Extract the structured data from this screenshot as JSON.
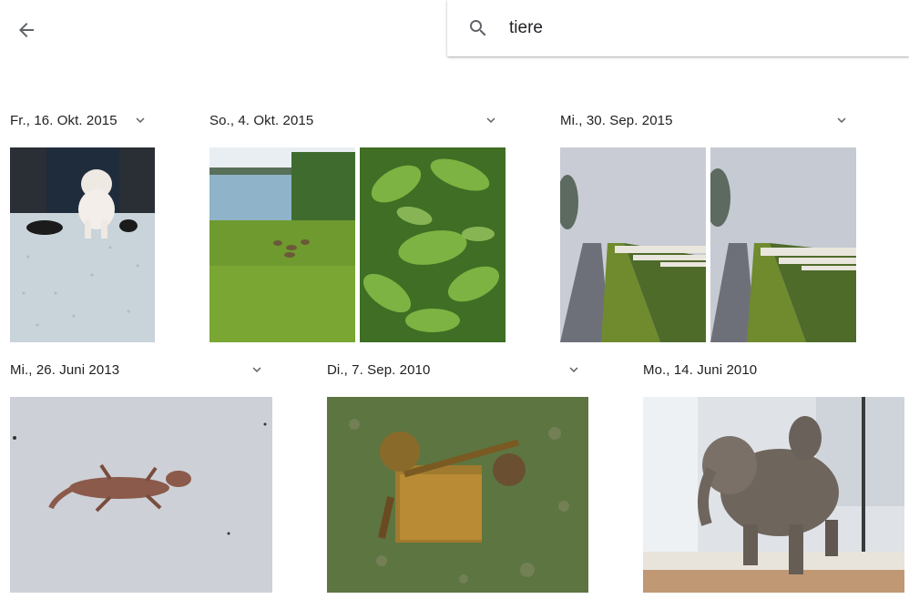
{
  "header": {
    "back_icon": "arrow-back-icon",
    "search_icon": "search-icon",
    "search_query": "tiere"
  },
  "groups": [
    {
      "date": "Fr., 16. Okt. 2015",
      "photos": [
        "white bulldog on speckled floor"
      ]
    },
    {
      "date": "So., 4. Okt. 2015",
      "photos": [
        "ducks on grassy lakeshore",
        "green leaves close-up"
      ]
    },
    {
      "date": "Mi., 30. Sep. 2015",
      "photos": [
        "sheep on foggy dike path",
        "sheep on foggy dike path"
      ]
    },
    {
      "date": "Mi., 26. Juni 2013",
      "photos": [
        "gecko on white wall"
      ]
    },
    {
      "date": "Di., 7. Sep. 2010",
      "photos": [
        "rusty machine sculpture on grass"
      ]
    },
    {
      "date": "Mo., 14. Juni 2010",
      "photos": [
        "elephant sculpture in glass museum"
      ]
    }
  ],
  "colors": {
    "text": "#202124",
    "icon": "#5f6368"
  }
}
